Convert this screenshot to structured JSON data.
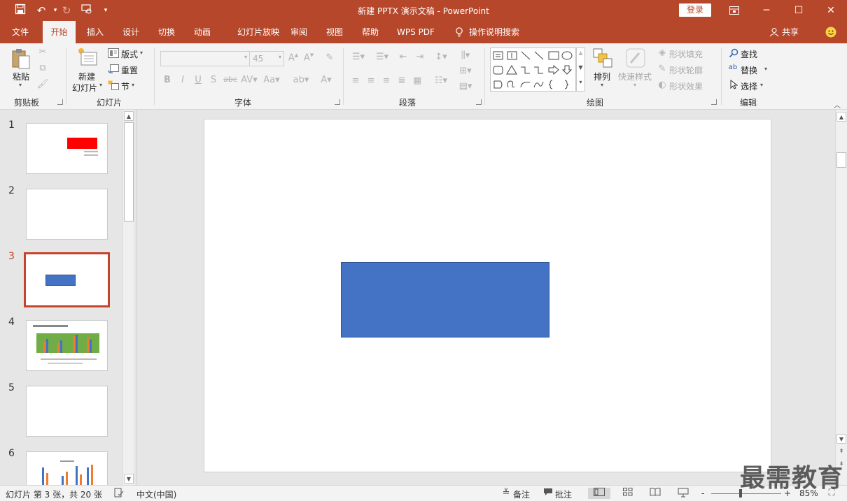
{
  "colors": {
    "accent": "#b7472a",
    "shape_fill": "#4472c4",
    "selected_thumb": "#c4452c"
  },
  "title_bar": {
    "doc_title": "新建 PPTX 演示文稿 - PowerPoint",
    "login_label": "登录",
    "quick_access_icons": [
      "save-icon",
      "undo-icon",
      "redo-icon",
      "slideshow-icon",
      "customize-icon"
    ],
    "window_buttons": [
      "ribbon-display-icon",
      "minimize-icon",
      "maximize-icon",
      "close-icon"
    ]
  },
  "menu": {
    "tabs": [
      "文件",
      "开始",
      "插入",
      "设计",
      "切换",
      "动画",
      "幻灯片放映",
      "审阅",
      "视图",
      "帮助",
      "WPS PDF"
    ],
    "active_tab": "开始",
    "tell_me": "操作说明搜索",
    "share": "共享"
  },
  "ribbon": {
    "clipboard": {
      "label": "剪贴板",
      "paste": "粘贴"
    },
    "slides": {
      "label": "幻灯片",
      "new_slide_1": "新建",
      "new_slide_2": "幻灯片",
      "layout": "版式",
      "reset": "重置",
      "section": "节"
    },
    "font": {
      "label": "字体",
      "font_name": "",
      "font_size": "45"
    },
    "paragraph": {
      "label": "段落"
    },
    "drawing": {
      "label": "绘图",
      "arrange": "排列",
      "quick_styles": "快速样式",
      "shape_fill": "形状填充",
      "shape_outline": "形状轮廓",
      "shape_effects": "形状效果"
    },
    "editing": {
      "label": "编辑",
      "find": "查找",
      "replace": "替换",
      "select": "选择"
    }
  },
  "slides": [
    {
      "num": "1",
      "selected": false
    },
    {
      "num": "2",
      "selected": false
    },
    {
      "num": "3",
      "selected": true
    },
    {
      "num": "4",
      "selected": false
    },
    {
      "num": "5",
      "selected": false
    },
    {
      "num": "6",
      "selected": false
    }
  ],
  "status": {
    "slide_info": "幻灯片 第 3 张，共 20 张",
    "language": "中文(中国)",
    "notes": "备注",
    "comments": "批注",
    "zoom": "85%",
    "zoom_minus": "-",
    "zoom_plus": "+"
  },
  "watermark": "最需教育"
}
